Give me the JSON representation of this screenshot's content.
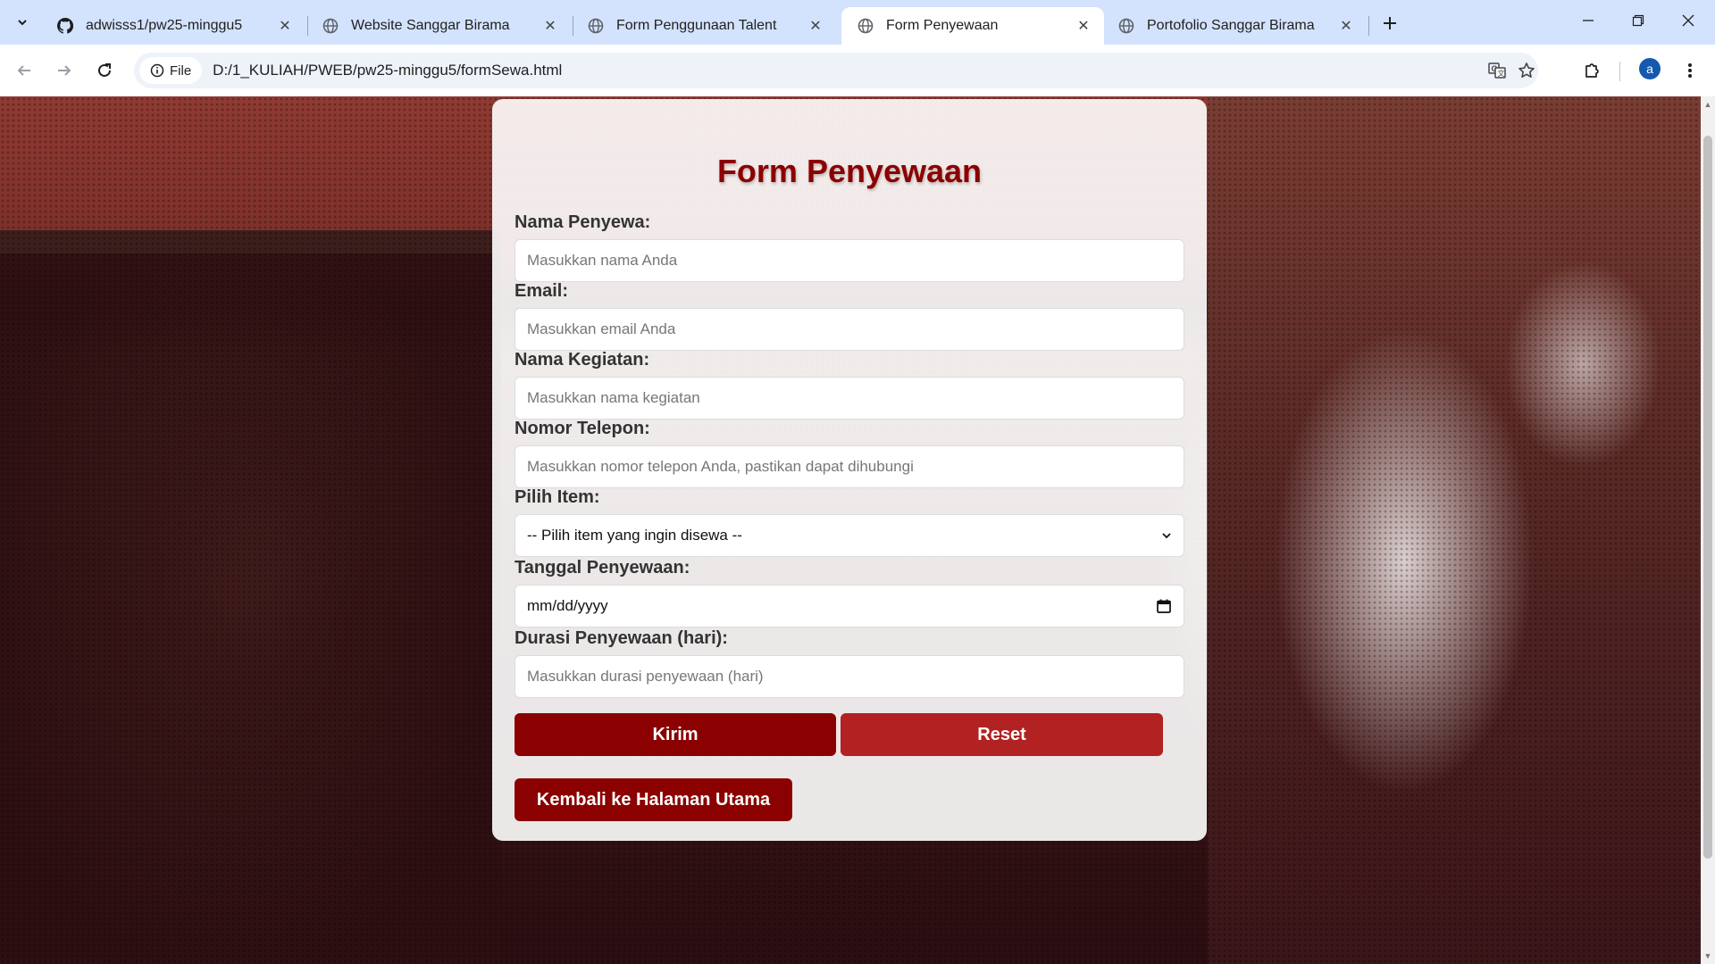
{
  "browser": {
    "tabs": [
      {
        "title": "adwisss1/pw25-minggu5",
        "icon": "github-icon",
        "active": false
      },
      {
        "title": "Website Sanggar Birama",
        "icon": "globe-icon",
        "active": false
      },
      {
        "title": "Form Penggunaan Talent",
        "icon": "globe-icon",
        "active": false
      },
      {
        "title": "Form Penyewaan",
        "icon": "globe-icon",
        "active": true
      },
      {
        "title": "Portofolio Sanggar Birama",
        "icon": "globe-icon",
        "active": false
      }
    ],
    "address": {
      "scheme_chip": "File",
      "url": "D:/1_KULIAH/PWEB/pw25-minggu5/formSewa.html"
    },
    "profile_initial": "a"
  },
  "form": {
    "title": "Form Penyewaan",
    "fields": {
      "nama": {
        "label": "Nama Penyewa:",
        "placeholder": "Masukkan nama Anda"
      },
      "email": {
        "label": "Email:",
        "placeholder": "Masukkan email Anda"
      },
      "kegiatan": {
        "label": "Nama Kegiatan:",
        "placeholder": "Masukkan nama kegiatan"
      },
      "telepon": {
        "label": "Nomor Telepon:",
        "placeholder": "Masukkan nomor telepon Anda, pastikan dapat dihubungi"
      },
      "item": {
        "label": "Pilih Item:",
        "selected": "-- Pilih item yang ingin disewa --"
      },
      "tanggal": {
        "label": "Tanggal Penyewaan:",
        "value": "mm/dd/yyyy"
      },
      "durasi": {
        "label": "Durasi Penyewaan (hari):",
        "placeholder": "Masukkan durasi penyewaan (hari)"
      }
    },
    "buttons": {
      "submit": "Kirim",
      "reset": "Reset",
      "back": "Kembali ke Halaman Utama"
    }
  },
  "colors": {
    "primary": "#8b0000",
    "secondary": "#b22222"
  }
}
